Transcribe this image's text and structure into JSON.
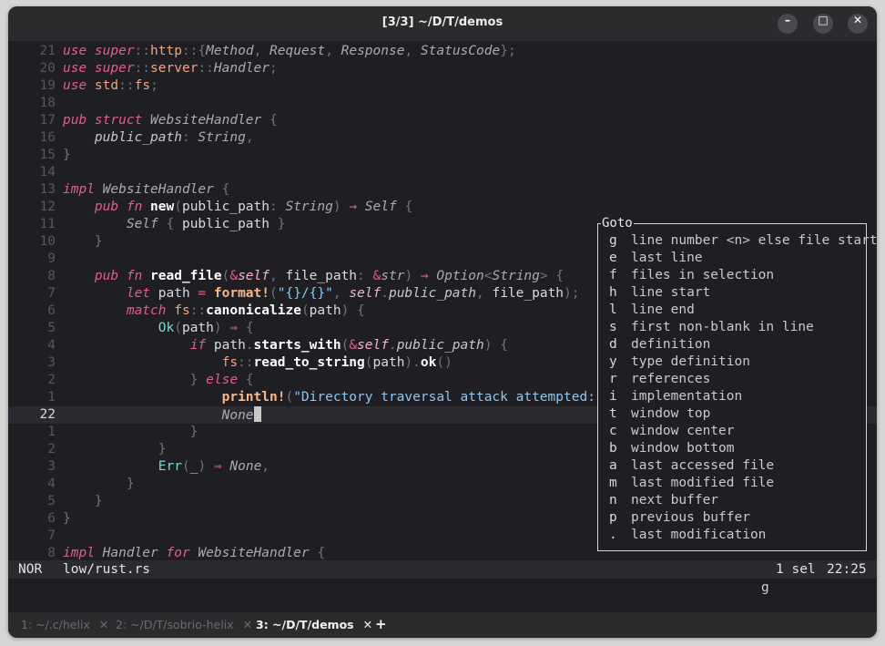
{
  "window": {
    "title": "[3/3] ~/D/T/demos",
    "controls": {
      "minimize": "–",
      "maximize": "□",
      "close": "✕"
    }
  },
  "editor": {
    "lines": [
      {
        "num": "21",
        "tokens": [
          [
            "kw",
            "use "
          ],
          [
            "kw",
            "super"
          ],
          [
            "pn",
            "::"
          ],
          [
            "ns",
            "http"
          ],
          [
            "pn",
            "::{"
          ],
          [
            "ty",
            "Method"
          ],
          [
            "pn",
            ", "
          ],
          [
            "ty",
            "Request"
          ],
          [
            "pn",
            ", "
          ],
          [
            "ty",
            "Response"
          ],
          [
            "pn",
            ", "
          ],
          [
            "ty",
            "StatusCode"
          ],
          [
            "pn",
            "};"
          ]
        ]
      },
      {
        "num": "20",
        "tokens": [
          [
            "kw",
            "use "
          ],
          [
            "kw",
            "super"
          ],
          [
            "pn",
            "::"
          ],
          [
            "ns",
            "server"
          ],
          [
            "pn",
            "::"
          ],
          [
            "ty",
            "Handler"
          ],
          [
            "pn",
            ";"
          ]
        ]
      },
      {
        "num": "19",
        "tokens": [
          [
            "kw",
            "use "
          ],
          [
            "ns",
            "std"
          ],
          [
            "pn",
            "::"
          ],
          [
            "ns",
            "fs"
          ],
          [
            "pn",
            ";"
          ]
        ]
      },
      {
        "num": "18",
        "tokens": []
      },
      {
        "num": "17",
        "tokens": [
          [
            "kw",
            "pub struct "
          ],
          [
            "ty",
            "WebsiteHandler"
          ],
          [
            "pn",
            " {"
          ]
        ]
      },
      {
        "num": "16",
        "tokens": [
          [
            "var",
            "    "
          ],
          [
            "prop",
            "public_path"
          ],
          [
            "pn",
            ": "
          ],
          [
            "ty",
            "String"
          ],
          [
            "pn",
            ","
          ]
        ]
      },
      {
        "num": "15",
        "tokens": [
          [
            "pn",
            "}"
          ]
        ]
      },
      {
        "num": "14",
        "tokens": []
      },
      {
        "num": "13",
        "tokens": [
          [
            "kw",
            "impl "
          ],
          [
            "ty",
            "WebsiteHandler"
          ],
          [
            "pn",
            " {"
          ]
        ]
      },
      {
        "num": "12",
        "tokens": [
          [
            "var",
            "    "
          ],
          [
            "kw",
            "pub fn "
          ],
          [
            "fn",
            "new"
          ],
          [
            "pn",
            "("
          ],
          [
            "var",
            "public_path"
          ],
          [
            "pn",
            ": "
          ],
          [
            "ty",
            "String"
          ],
          [
            "pn",
            ") "
          ],
          [
            "op",
            "→ "
          ],
          [
            "ty",
            "Self"
          ],
          [
            "pn",
            " {"
          ]
        ]
      },
      {
        "num": "11",
        "tokens": [
          [
            "var",
            "        "
          ],
          [
            "ty",
            "Self"
          ],
          [
            "pn",
            " { "
          ],
          [
            "var",
            "public_path"
          ],
          [
            "pn",
            " }"
          ]
        ]
      },
      {
        "num": "10",
        "tokens": [
          [
            "pn",
            "    }"
          ]
        ]
      },
      {
        "num": "9",
        "tokens": []
      },
      {
        "num": "8",
        "tokens": [
          [
            "var",
            "    "
          ],
          [
            "kw",
            "pub fn "
          ],
          [
            "fn",
            "read_file"
          ],
          [
            "pn",
            "("
          ],
          [
            "op",
            "&"
          ],
          [
            "vari",
            "self"
          ],
          [
            "pn",
            ", "
          ],
          [
            "var",
            "file_path"
          ],
          [
            "pn",
            ": "
          ],
          [
            "op",
            "&"
          ],
          [
            "ty",
            "str"
          ],
          [
            "pn",
            ") "
          ],
          [
            "op",
            "→ "
          ],
          [
            "ty",
            "Option"
          ],
          [
            "pn",
            "<"
          ],
          [
            "ty",
            "String"
          ],
          [
            "pn",
            "> {"
          ]
        ]
      },
      {
        "num": "7",
        "tokens": [
          [
            "var",
            "        "
          ],
          [
            "kw",
            "let "
          ],
          [
            "var",
            "path "
          ],
          [
            "op",
            "= "
          ],
          [
            "mac",
            "format!"
          ],
          [
            "pn",
            "("
          ],
          [
            "str",
            "\"{}/{}\""
          ],
          [
            "pn",
            ", "
          ],
          [
            "vari",
            "self"
          ],
          [
            "pn",
            "."
          ],
          [
            "prop",
            "public_path"
          ],
          [
            "pn",
            ", "
          ],
          [
            "var",
            "file_path"
          ],
          [
            "pn",
            ");"
          ]
        ]
      },
      {
        "num": "6",
        "tokens": [
          [
            "var",
            "        "
          ],
          [
            "kw",
            "match "
          ],
          [
            "ns",
            "fs"
          ],
          [
            "pn",
            "::"
          ],
          [
            "fn",
            "canonicalize"
          ],
          [
            "pn",
            "("
          ],
          [
            "var",
            "path"
          ],
          [
            "pn",
            ") {"
          ]
        ]
      },
      {
        "num": "5",
        "tokens": [
          [
            "var",
            "            "
          ],
          [
            "en",
            "Ok"
          ],
          [
            "pn",
            "("
          ],
          [
            "var",
            "path"
          ],
          [
            "pn",
            ") "
          ],
          [
            "op",
            "⇒ "
          ],
          [
            "pn",
            "{"
          ]
        ]
      },
      {
        "num": "4",
        "tokens": [
          [
            "var",
            "                "
          ],
          [
            "kw",
            "if "
          ],
          [
            "var",
            "path"
          ],
          [
            "pn",
            "."
          ],
          [
            "fn",
            "starts_with"
          ],
          [
            "pn",
            "("
          ],
          [
            "op",
            "&"
          ],
          [
            "vari",
            "self"
          ],
          [
            "pn",
            "."
          ],
          [
            "prop",
            "public_path"
          ],
          [
            "pn",
            ") {"
          ]
        ]
      },
      {
        "num": "3",
        "tokens": [
          [
            "var",
            "                    "
          ],
          [
            "ns",
            "fs"
          ],
          [
            "pn",
            "::"
          ],
          [
            "fn",
            "read_to_string"
          ],
          [
            "pn",
            "("
          ],
          [
            "var",
            "path"
          ],
          [
            "pn",
            ")."
          ],
          [
            "fn",
            "ok"
          ],
          [
            "pn",
            "()"
          ]
        ]
      },
      {
        "num": "2",
        "tokens": [
          [
            "pn",
            "                } "
          ],
          [
            "kw",
            "else "
          ],
          [
            "pn",
            "{"
          ]
        ]
      },
      {
        "num": "1",
        "tokens": [
          [
            "var",
            "                    "
          ],
          [
            "mac",
            "println!"
          ],
          [
            "pn",
            "("
          ],
          [
            "str",
            "\"Directory traversal attack attempted: {}\""
          ],
          [
            "pn",
            ","
          ]
        ]
      },
      {
        "num": "22",
        "current": true,
        "tokens": [
          [
            "var",
            "                    "
          ],
          [
            "ty",
            "None"
          ]
        ]
      },
      {
        "num": "1",
        "tokens": [
          [
            "pn",
            "                }"
          ]
        ]
      },
      {
        "num": "2",
        "tokens": [
          [
            "pn",
            "            }"
          ]
        ]
      },
      {
        "num": "3",
        "tokens": [
          [
            "var",
            "            "
          ],
          [
            "en",
            "Err"
          ],
          [
            "pn",
            "("
          ],
          [
            "var",
            "_"
          ],
          [
            "pn",
            ") "
          ],
          [
            "op",
            "⇒ "
          ],
          [
            "ty",
            "None"
          ],
          [
            "pn",
            ","
          ]
        ]
      },
      {
        "num": "4",
        "tokens": [
          [
            "pn",
            "        }"
          ]
        ]
      },
      {
        "num": "5",
        "tokens": [
          [
            "pn",
            "    }"
          ]
        ]
      },
      {
        "num": "6",
        "tokens": [
          [
            "pn",
            "}"
          ]
        ]
      },
      {
        "num": "7",
        "tokens": []
      },
      {
        "num": "8",
        "tokens": [
          [
            "kw",
            "impl "
          ],
          [
            "ty",
            "Handler "
          ],
          [
            "kw",
            "for "
          ],
          [
            "ty",
            "WebsiteHandler"
          ],
          [
            "pn",
            " {"
          ]
        ]
      }
    ]
  },
  "goto_popup": {
    "title": "Goto",
    "items": [
      {
        "key": "g",
        "label": "line number <n> else file start"
      },
      {
        "key": "e",
        "label": "last line"
      },
      {
        "key": "f",
        "label": "files in selection"
      },
      {
        "key": "h",
        "label": "line start"
      },
      {
        "key": "l",
        "label": "line end"
      },
      {
        "key": "s",
        "label": "first non-blank in line"
      },
      {
        "key": "d",
        "label": "definition"
      },
      {
        "key": "y",
        "label": "type definition"
      },
      {
        "key": "r",
        "label": "references"
      },
      {
        "key": "i",
        "label": "implementation"
      },
      {
        "key": "t",
        "label": "window top"
      },
      {
        "key": "c",
        "label": "window center"
      },
      {
        "key": "b",
        "label": "window bottom"
      },
      {
        "key": "a",
        "label": "last accessed file"
      },
      {
        "key": "m",
        "label": "last modified file"
      },
      {
        "key": "n",
        "label": "next buffer"
      },
      {
        "key": "p",
        "label": "previous buffer"
      },
      {
        "key": ".",
        "label": "last modification"
      }
    ]
  },
  "statusbar": {
    "mode": "NOR",
    "file": "low/rust.rs",
    "selections": "1 sel",
    "position": "22:25"
  },
  "cmdline": {
    "pending_key": "g"
  },
  "tabs": [
    {
      "label": "1: ~/.c/helix",
      "close": "✕",
      "active": false
    },
    {
      "label": "2: ~/D/T/sobrio-helix",
      "close": "✕",
      "active": false
    },
    {
      "label": "3: ~/D/T/demos",
      "close": "✕",
      "active": true
    }
  ],
  "new_tab": "+",
  "colors": {
    "keyword": "#e05d8d",
    "type": "#a9abb2",
    "function": "#ffffff",
    "macro": "#f6b88a",
    "string": "#8bc8f0",
    "enum_variant": "#79d9d4",
    "editor_bg": "#1f1f23"
  }
}
